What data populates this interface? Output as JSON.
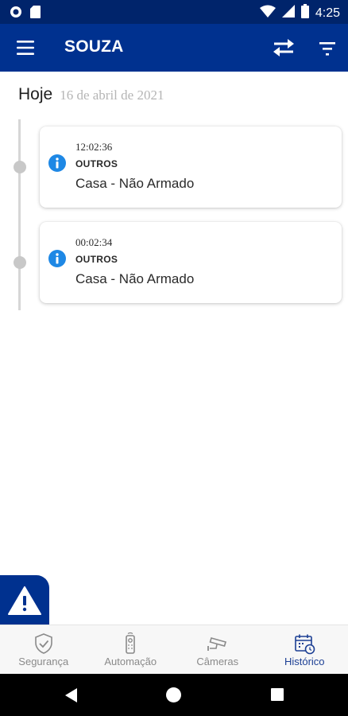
{
  "status_bar": {
    "time": "4:25"
  },
  "app_bar": {
    "title": "SOUZA"
  },
  "history": {
    "day_label": "Hoje",
    "date": "16 de abril de 2021",
    "events": [
      {
        "time": "12:02:36",
        "type": "OUTROS",
        "description": "Casa - Não Armado"
      },
      {
        "time": "00:02:34",
        "type": "OUTROS",
        "description": "Casa - Não Armado"
      }
    ]
  },
  "bottom_nav": {
    "items": [
      {
        "label": "Segurança",
        "icon": "shield-check-icon",
        "active": false
      },
      {
        "label": "Automação",
        "icon": "remote-control-icon",
        "active": false
      },
      {
        "label": "Câmeras",
        "icon": "security-camera-icon",
        "active": false
      },
      {
        "label": "Histórico",
        "icon": "calendar-clock-icon",
        "active": true
      }
    ]
  },
  "colors": {
    "status_bar": "#00246b",
    "app_bar": "#00318f",
    "info_accent": "#1e88e5",
    "active_nav": "#1c3f94"
  }
}
